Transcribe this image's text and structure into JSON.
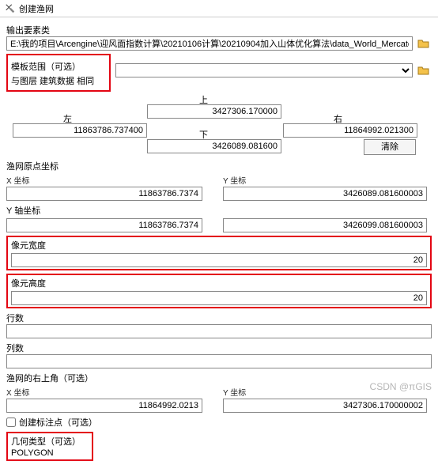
{
  "window": {
    "title": "创建渔网"
  },
  "output": {
    "label": "输出要素类",
    "value": "E:\\我的项目\\Arcengine\\迎风面指数计算\\20210106计算\\20210904加入山体优化算法\\data_World_Mercator.gdb\\迎"
  },
  "template": {
    "label": "模板范围（可选）",
    "value": "与图层 建筑数据 相同"
  },
  "extent": {
    "top_label": "上",
    "top": "3427306.170000",
    "left_label": "左",
    "left": "11863786.737400",
    "right_label": "右",
    "right": "11864992.021300",
    "bottom_label": "下",
    "bottom": "3426089.081600",
    "clear": "清除"
  },
  "origin": {
    "section": "渔网原点坐标",
    "x_label": "X 坐标",
    "x": "11863786.7374",
    "y_label": "Y 坐标",
    "y": "3426089.081600003"
  },
  "yaxis": {
    "section": "Y 轴坐标",
    "x": "11863786.7374",
    "y": "3426099.081600003"
  },
  "cell_w": {
    "label": "像元宽度",
    "value": "20"
  },
  "cell_h": {
    "label": "像元高度",
    "value": "20"
  },
  "rows": {
    "label": "行数",
    "value": ""
  },
  "cols": {
    "label": "列数",
    "value": ""
  },
  "upper_right": {
    "section": "渔网的右上角（可选）",
    "x_label": "X 坐标",
    "x": "11864992.0213",
    "y_label": "Y 坐标",
    "y": "3427306.170000002"
  },
  "create_labels": {
    "label": "创建标注点（可选）"
  },
  "geom": {
    "label": "几何类型（可选）",
    "value": "POLYGON"
  },
  "watermark": "CSDN @πGIS"
}
